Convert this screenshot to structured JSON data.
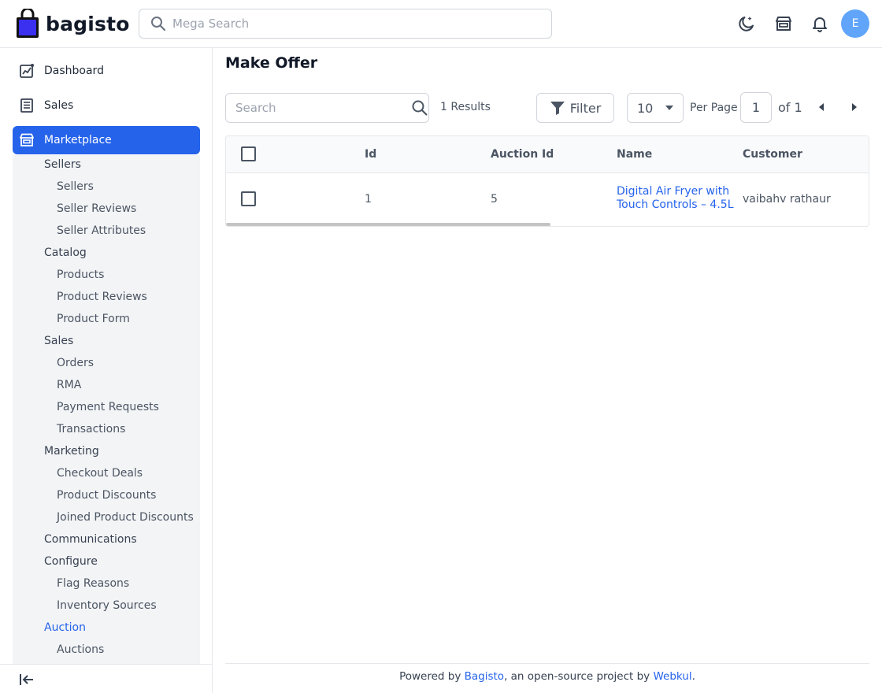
{
  "header": {
    "brand": "bagisto",
    "search_placeholder": "Mega Search",
    "avatar_initial": "E"
  },
  "sidebar": {
    "main": [
      {
        "label": "Dashboard"
      },
      {
        "label": "Sales"
      },
      {
        "label": "Marketplace"
      }
    ],
    "marketplace_groups": {
      "sellers": "Sellers",
      "sellers_items": [
        "Sellers",
        "Seller Reviews",
        "Seller Attributes"
      ],
      "catalog": "Catalog",
      "catalog_items": [
        "Products",
        "Product Reviews",
        "Product Form"
      ],
      "sales": "Sales",
      "sales_items": [
        "Orders",
        "RMA",
        "Payment Requests",
        "Transactions"
      ],
      "marketing": "Marketing",
      "marketing_items": [
        "Checkout Deals",
        "Product Discounts",
        "Joined Product Discounts"
      ],
      "communications": "Communications",
      "configure": "Configure",
      "configure_items": [
        "Flag Reasons",
        "Inventory Sources"
      ],
      "auction": "Auction",
      "auction_items": [
        "Auctions"
      ]
    }
  },
  "page": {
    "title": "Make Offer",
    "search_placeholder": "Search",
    "results": "1 Results",
    "filter_label": "Filter",
    "per_page_value": "10",
    "per_page_label": "Per Page",
    "current_page": "1",
    "of_label": "of 1"
  },
  "table": {
    "columns": [
      "Id",
      "Auction Id",
      "Name",
      "Customer"
    ],
    "rows": [
      {
        "id": "1",
        "auction_id": "5",
        "name_line1": "Digital Air Fryer with",
        "name_line2": "Touch Controls – 4.5L",
        "customer": "vaibahv rathaur"
      }
    ]
  },
  "footer": {
    "prefix": "Powered by ",
    "link1": "Bagisto",
    "middle": ", an open-source project by ",
    "link2": "Webkul",
    "suffix": "."
  },
  "colors": {
    "accent": "#2563eb",
    "avatar": "#60a5fa",
    "sidebar_bg": "#f3f4f6"
  }
}
